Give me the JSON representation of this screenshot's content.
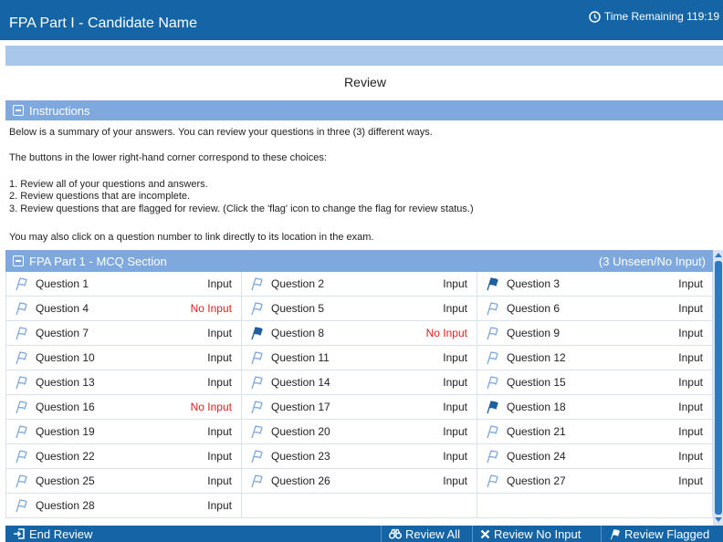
{
  "header": {
    "app_title": "FPA Part I - Candidate Name",
    "timer_label": "Time Remaining 119:19"
  },
  "page_title": "Review",
  "instructions": {
    "header": "Instructions",
    "lines": [
      "Below is a summary of your answers. You can review your questions in three (3) different ways.",
      "The buttons in the lower right-hand corner correspond to these choices:",
      "1. Review all of your questions and answers.",
      "2. Review questions that are incomplete.",
      "3. Review questions that are flagged for review. (Click the 'flag' icon to change the flag for review status.)",
      "You may also click on a question number to link directly to its location in the exam."
    ]
  },
  "section": {
    "title": "FPA Part 1 - MCQ Section",
    "count_label": "(3 Unseen/No Input)"
  },
  "questions": [
    {
      "label": "Question 1",
      "status": "Input",
      "flagged": false,
      "incomplete": false
    },
    {
      "label": "Question 2",
      "status": "Input",
      "flagged": false,
      "incomplete": false
    },
    {
      "label": "Question 3",
      "status": "Input",
      "flagged": true,
      "incomplete": false
    },
    {
      "label": "Question 4",
      "status": "No Input",
      "flagged": false,
      "incomplete": true
    },
    {
      "label": "Question 5",
      "status": "Input",
      "flagged": false,
      "incomplete": false
    },
    {
      "label": "Question 6",
      "status": "Input",
      "flagged": false,
      "incomplete": false
    },
    {
      "label": "Question 7",
      "status": "Input",
      "flagged": false,
      "incomplete": false
    },
    {
      "label": "Question 8",
      "status": "No Input",
      "flagged": true,
      "incomplete": true
    },
    {
      "label": "Question 9",
      "status": "Input",
      "flagged": false,
      "incomplete": false
    },
    {
      "label": "Question 10",
      "status": "Input",
      "flagged": false,
      "incomplete": false
    },
    {
      "label": "Question 11",
      "status": "Input",
      "flagged": false,
      "incomplete": false
    },
    {
      "label": "Question 12",
      "status": "Input",
      "flagged": false,
      "incomplete": false
    },
    {
      "label": "Question 13",
      "status": "Input",
      "flagged": false,
      "incomplete": false
    },
    {
      "label": "Question 14",
      "status": "Input",
      "flagged": false,
      "incomplete": false
    },
    {
      "label": "Question 15",
      "status": "Input",
      "flagged": false,
      "incomplete": false
    },
    {
      "label": "Question 16",
      "status": "No Input",
      "flagged": false,
      "incomplete": true
    },
    {
      "label": "Question 17",
      "status": "Input",
      "flagged": false,
      "incomplete": false
    },
    {
      "label": "Question 18",
      "status": "Input",
      "flagged": true,
      "incomplete": false
    },
    {
      "label": "Question 19",
      "status": "Input",
      "flagged": false,
      "incomplete": false
    },
    {
      "label": "Question 20",
      "status": "Input",
      "flagged": false,
      "incomplete": false
    },
    {
      "label": "Question 21",
      "status": "Input",
      "flagged": false,
      "incomplete": false
    },
    {
      "label": "Question 22",
      "status": "Input",
      "flagged": false,
      "incomplete": false
    },
    {
      "label": "Question 23",
      "status": "Input",
      "flagged": false,
      "incomplete": false
    },
    {
      "label": "Question 24",
      "status": "Input",
      "flagged": false,
      "incomplete": false
    },
    {
      "label": "Question 25",
      "status": "Input",
      "flagged": false,
      "incomplete": false
    },
    {
      "label": "Question 26",
      "status": "Input",
      "flagged": false,
      "incomplete": false
    },
    {
      "label": "Question 27",
      "status": "Input",
      "flagged": false,
      "incomplete": false
    },
    {
      "label": "Question 28",
      "status": "Input",
      "flagged": false,
      "incomplete": false
    }
  ],
  "footer": {
    "end_review": "End Review",
    "review_all": "Review All",
    "review_no_input": "Review No Input",
    "review_flagged": "Review Flagged"
  },
  "icons": {
    "flag_outline": "flag-outline-icon",
    "flag_filled": "flag-filled-icon",
    "clock": "clock-icon",
    "end_review": "exit-icon",
    "review_all": "binoculars-icon",
    "review_no_input": "x-icon",
    "review_flagged": "flag-icon"
  },
  "colors": {
    "header_bg": "#1565a6",
    "bar_bg": "#7fa9de",
    "subbar_bg": "#a8c7ea",
    "no_input": "#e02020",
    "flag_filled": "#1f5f9e",
    "flag_outline": "#7fa9de"
  }
}
